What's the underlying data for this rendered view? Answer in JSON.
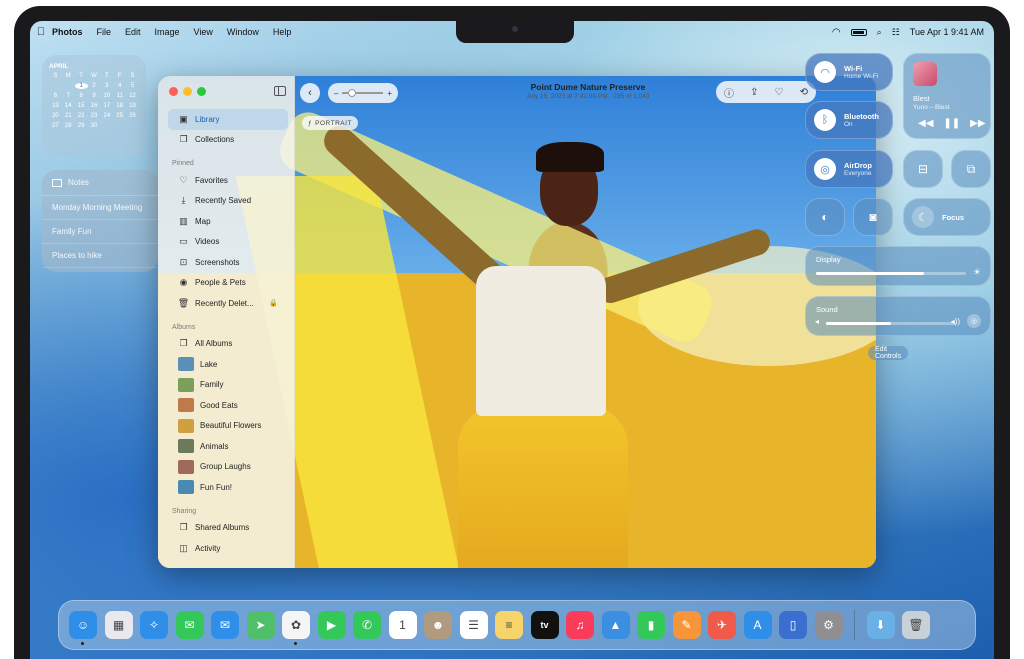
{
  "menubar": {
    "app": "Photos",
    "items": [
      "File",
      "Edit",
      "Image",
      "View",
      "Window",
      "Help"
    ],
    "clock": "Tue Apr 1  9:41 AM"
  },
  "calendar": {
    "month": "APRIL",
    "weekdays": [
      "S",
      "M",
      "T",
      "W",
      "T",
      "F",
      "S"
    ],
    "days": [
      "",
      "",
      "1",
      "2",
      "3",
      "4",
      "5",
      "6",
      "7",
      "8",
      "9",
      "10",
      "11",
      "12",
      "13",
      "14",
      "15",
      "16",
      "17",
      "18",
      "19",
      "20",
      "21",
      "22",
      "23",
      "24",
      "25",
      "26",
      "27",
      "28",
      "29",
      "30",
      "",
      "",
      ""
    ],
    "today": "1"
  },
  "notes": {
    "title": "Notes",
    "items": [
      "Monday Morning Meeting",
      "Family Fun",
      "Places to hike"
    ]
  },
  "photos": {
    "title": "Point Dume Nature Preserve",
    "subtitle": "July 16, 2023 at 7:41:03 PM  ·  235 of 1,040",
    "portrait_label": "PORTRAIT",
    "sidebar": {
      "top": [
        {
          "label": "Library",
          "icon": "library-icon",
          "glyph": "▣",
          "active": true
        },
        {
          "label": "Collections",
          "icon": "collections-icon",
          "glyph": "❐"
        }
      ],
      "pinned_header": "Pinned",
      "pinned": [
        {
          "label": "Favorites",
          "icon": "heart-icon",
          "glyph": "♡"
        },
        {
          "label": "Recently Saved",
          "icon": "download-icon",
          "glyph": "⤓"
        },
        {
          "label": "Map",
          "icon": "map-icon",
          "glyph": "▥"
        },
        {
          "label": "Videos",
          "icon": "video-icon",
          "glyph": "▭"
        },
        {
          "label": "Screenshots",
          "icon": "screenshot-icon",
          "glyph": "⊡"
        },
        {
          "label": "People & Pets",
          "icon": "person-icon",
          "glyph": "◉"
        },
        {
          "label": "Recently Delet...",
          "icon": "trash-icon",
          "glyph": "🗑",
          "locked": true
        }
      ],
      "albums_header": "Albums",
      "albums": [
        {
          "label": "All Albums",
          "icon": "albums-icon",
          "glyph": "❐"
        },
        {
          "label": "Lake",
          "color": "#5a8fb8"
        },
        {
          "label": "Family",
          "color": "#7aa05a"
        },
        {
          "label": "Good Eats",
          "color": "#c07a4a"
        },
        {
          "label": "Beautiful Flowers",
          "color": "#d0a040"
        },
        {
          "label": "Animals",
          "color": "#6a7a5a"
        },
        {
          "label": "Group Laughs",
          "color": "#a06a5a"
        },
        {
          "label": "Fun Fun!",
          "color": "#4a8ab0"
        }
      ],
      "sharing_header": "Sharing",
      "sharing": [
        {
          "label": "Shared Albums",
          "icon": "shared-albums-icon",
          "glyph": "❐"
        },
        {
          "label": "Activity",
          "icon": "activity-icon",
          "glyph": "◫"
        }
      ]
    }
  },
  "control_center": {
    "wifi": {
      "label": "Wi-Fi",
      "sub": "Home Wi-Fi"
    },
    "bluetooth": {
      "label": "Bluetooth",
      "sub": "On"
    },
    "airdrop": {
      "label": "AirDrop",
      "sub": "Everyone"
    },
    "now_playing": {
      "title": "Blest",
      "artist": "Yuno – Blest"
    },
    "focus": "Focus",
    "display": {
      "label": "Display",
      "level": 0.72
    },
    "sound": {
      "label": "Sound",
      "level": 0.5
    },
    "edit": "Edit Controls"
  },
  "dock": [
    {
      "name": "finder",
      "color": "#2f8fe8",
      "glyph": "☺",
      "running": true
    },
    {
      "name": "launchpad",
      "color": "#e8e8ee",
      "glyph": "▦"
    },
    {
      "name": "safari",
      "color": "#2f8fe8",
      "glyph": "✧"
    },
    {
      "name": "messages",
      "color": "#34c759",
      "glyph": "✉"
    },
    {
      "name": "mail",
      "color": "#2f8fe8",
      "glyph": "✉"
    },
    {
      "name": "maps",
      "color": "#4fbf6a",
      "glyph": "➤"
    },
    {
      "name": "photos",
      "color": "#f5f5f5",
      "glyph": "✿",
      "running": true
    },
    {
      "name": "facetime",
      "color": "#34c759",
      "glyph": "▶"
    },
    {
      "name": "phone",
      "color": "#34c759",
      "glyph": "✆"
    },
    {
      "name": "calendar",
      "color": "#ffffff",
      "glyph": "1"
    },
    {
      "name": "contacts",
      "color": "#b09a80",
      "glyph": "☻"
    },
    {
      "name": "reminders",
      "color": "#ffffff",
      "glyph": "☰"
    },
    {
      "name": "notes",
      "color": "#f7d46a",
      "glyph": "≡"
    },
    {
      "name": "tv",
      "color": "#111111",
      "glyph": "tv"
    },
    {
      "name": "music",
      "color": "#fa3c5a",
      "glyph": "♫"
    },
    {
      "name": "keynote",
      "color": "#3a8fe0",
      "glyph": "▲"
    },
    {
      "name": "numbers",
      "color": "#34c759",
      "glyph": "▮"
    },
    {
      "name": "pages",
      "color": "#f7953b",
      "glyph": "✎"
    },
    {
      "name": "games",
      "color": "#f05a4a",
      "glyph": "✈"
    },
    {
      "name": "app-store",
      "color": "#2f8fe8",
      "glyph": "A"
    },
    {
      "name": "iphone-mirroring",
      "color": "#3a6fd0",
      "glyph": "▯"
    },
    {
      "name": "system-settings",
      "color": "#8e8e93",
      "glyph": "⚙"
    },
    {
      "name": "downloads",
      "color": "#6ab0e6",
      "glyph": "⬇"
    },
    {
      "name": "trash",
      "color": "#c8d0d8",
      "glyph": "🗑"
    }
  ]
}
